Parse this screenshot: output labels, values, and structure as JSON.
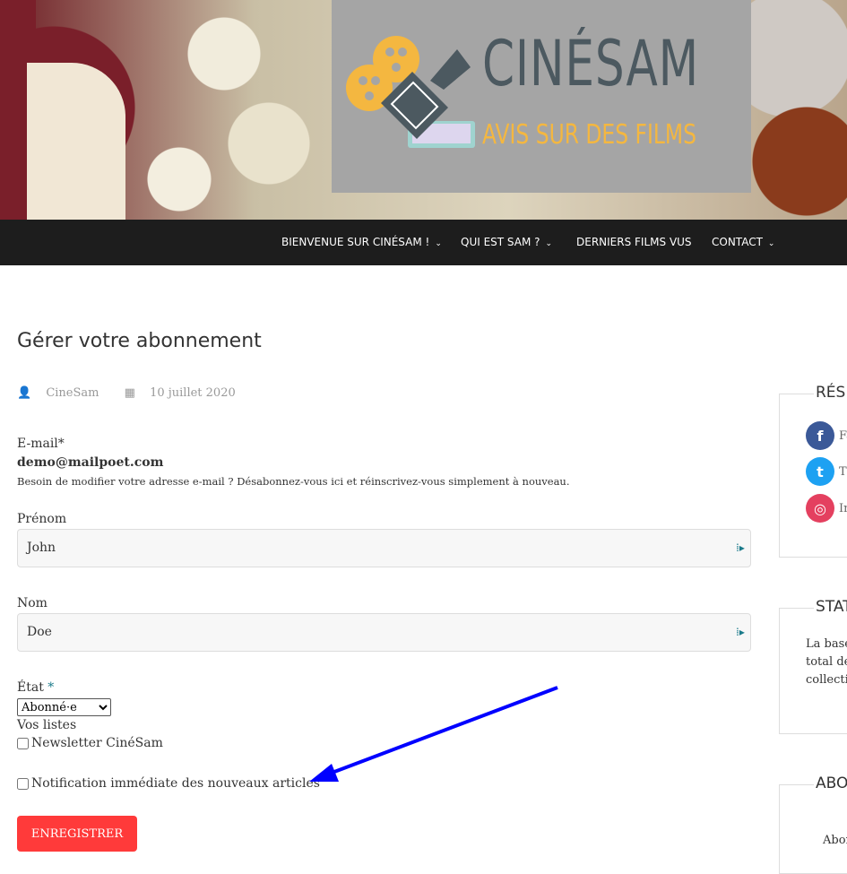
{
  "logo": {
    "title": "CINÉSAM",
    "subtitle": "AVIS SUR DES FILMS"
  },
  "nav": {
    "items": [
      {
        "label": "BIENVENUE SUR CINÉSAM !",
        "dropdown": true
      },
      {
        "label": "QUI EST SAM ?",
        "dropdown": true
      },
      {
        "label": "DERNIERS FILMS VUS",
        "dropdown": false
      },
      {
        "label": "CONTACT",
        "dropdown": true
      }
    ]
  },
  "page": {
    "title": "Gérer votre abonnement",
    "author": "CineSam",
    "date": "10 juillet 2020"
  },
  "form": {
    "email_label": "E-mail*",
    "email_value": "demo@mailpoet.com",
    "email_help": "Besoin de modifier votre adresse e-mail ? Désabonnez-vous ici et réinscrivez-vous simplement à nouveau.",
    "firstname_label": "Prénom",
    "firstname_value": "John",
    "lastname_label": "Nom",
    "lastname_value": "Doe",
    "state_label": "État",
    "state_required": "*",
    "state_value": "Abonné·e",
    "lists_label": "Vos listes",
    "lists": [
      {
        "label": "Newsletter CinéSam",
        "checked": false
      },
      {
        "label": "Notification immédiate des nouveaux articles",
        "checked": false
      }
    ],
    "submit": "ENREGISTRER"
  },
  "sidebar": {
    "social_title": "RÉSE",
    "social": [
      {
        "icon": "facebook-icon",
        "label": "Fa",
        "color": "#3b5998"
      },
      {
        "icon": "twitter-icon",
        "label": "T",
        "color": "#1da1f2"
      },
      {
        "icon": "instagram-icon",
        "label": "In",
        "color": "#e4405f"
      }
    ],
    "stats_title": "STAT",
    "stats_lines": [
      "La base",
      "total de",
      "collectio"
    ],
    "about_title": "ABO",
    "about_text": "Abon"
  },
  "annotation": {
    "arrow_color": "#0000ff"
  }
}
